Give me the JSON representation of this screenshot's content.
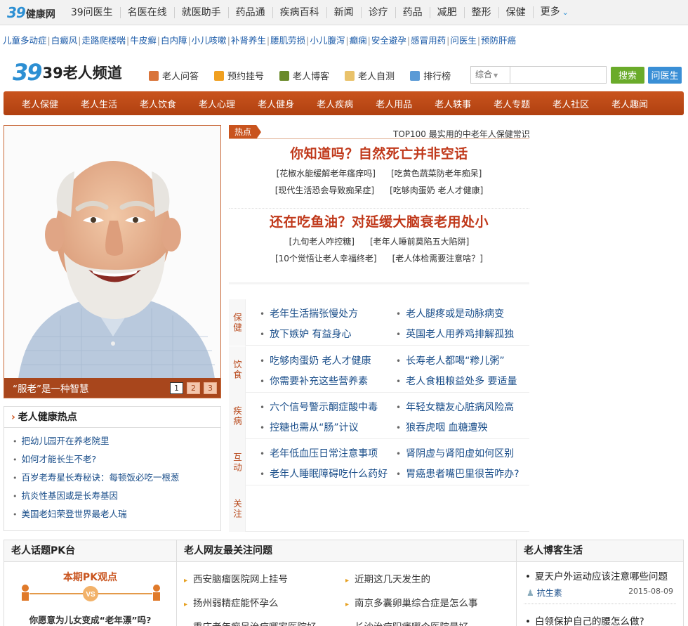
{
  "topnav": {
    "logo_num": "39",
    "logo_text": "健康网",
    "items": [
      "39问医生",
      "名医在线",
      "就医助手",
      "药品通",
      "疾病百科",
      "新闻",
      "诊疗",
      "药品",
      "减肥",
      "整形",
      "保健"
    ],
    "more_label": "更多"
  },
  "keywords": [
    "儿童多动症",
    "白癜风",
    "走路爬楼喘",
    "牛皮癣",
    "白内障",
    "小儿咳嗽",
    "补肾养生",
    "腰肌劳损",
    "小儿腹泻",
    "癫痫",
    "安全避孕",
    "感冒用药",
    "问医生",
    "预防肝癌"
  ],
  "channel": {
    "logo_num": "39",
    "title": "39老人频道",
    "quick_links": [
      {
        "label": "老人问答",
        "icon": "person-ask-icon"
      },
      {
        "label": "预约挂号",
        "icon": "calendar-icon"
      },
      {
        "label": "老人博客",
        "icon": "blog-icon"
      },
      {
        "label": "老人自测",
        "icon": "self-test-icon"
      },
      {
        "label": "排行榜",
        "icon": "bar-chart-icon"
      }
    ]
  },
  "search": {
    "type_label": "综合",
    "placeholder": "",
    "button_label": "搜索",
    "ask_label": "问医生",
    "colors": {
      "search": "#6aab2a",
      "ask": "#3a8fd6"
    }
  },
  "categories": [
    "老人保健",
    "老人生活",
    "老人饮食",
    "老人心理",
    "老人健身",
    "老人疾病",
    "老人用品",
    "老人轶事",
    "老人专题",
    "老人社区",
    "老人趣闻"
  ],
  "slideshow": {
    "caption": "“服老”是一种智慧",
    "pages": [
      "1",
      "2",
      "3"
    ],
    "current": "1"
  },
  "hot_box": {
    "title": "老人健康热点",
    "items": [
      "把幼儿园开在养老院里",
      "如何才能长生不老?",
      "百岁老寿星长寿秘诀：每顿饭必吃一根葱",
      "抗炎性基因或是长寿基因",
      "美国老妇荣登世界最老人瑞"
    ]
  },
  "headlines": {
    "tag": "热点",
    "top100": "TOP100 最实用的中老年人保健常识",
    "h1": "你知道吗？自然死亡并非空话",
    "h1_subs": [
      [
        "[花椒水能缓解老年瘙痒吗]",
        "[吃黄色蔬菜防老年痴呆]"
      ],
      [
        "[现代生活恐会导致痴呆症]",
        "[吃够肉蛋奶 老人才健康]"
      ]
    ],
    "h2": "还在吃鱼油？对延缓大脑衰老用处小",
    "h2_subs": [
      [
        "[九旬老人咋控糖]",
        "[老年人睡前莫陷五大陷阱]"
      ],
      [
        "[10个觉悟让老人幸福终老]",
        "[老人体检需要注意啥？]"
      ]
    ]
  },
  "category_rows": [
    {
      "label": "保健",
      "items": [
        "老年生活揣张慢处方",
        "老人腿疼或是动脉病变",
        "放下嫉妒 有益身心",
        "英国老人用养鸡排解孤独"
      ]
    },
    {
      "label": "饮食",
      "items": [
        "吃够肉蛋奶 老人才健康",
        "长寿老人都喝“糁儿粥”",
        "你需要补充这些营养素",
        "老人食粗粮益处多 要适量"
      ]
    },
    {
      "label": "疾病",
      "items": [
        "六个信号警示酮症酸中毒",
        "年轻女糖友心脏病风险高",
        "控糖也需从“肠”计议",
        "狼吞虎咽 血糖遭殃"
      ]
    },
    {
      "label": "互动",
      "items": [
        "老年低血压日常注意事项",
        "肾阴虚与肾阳虚如何区别",
        "老年人睡眠障碍吃什么药好",
        "胃癌患者嘴巴里很苦咋办?"
      ]
    },
    {
      "label": "关注",
      "items": []
    }
  ],
  "bottom": {
    "pk": {
      "title": "老人话题PK台",
      "subtitle": "本期PK观点",
      "vs": "VS",
      "question": "你愿意为儿女变成“老年漂”吗?"
    },
    "questions": {
      "title": "老人网友最关注问题",
      "left": [
        "西安脑瘤医院网上挂号",
        "扬州弱精症能怀孕么",
        "重庆老年痴呆治疗哪家医院好"
      ],
      "right": [
        "近期这几天发生的",
        "南京多囊卵巢综合症是怎么事",
        "长沙治疗阳痿哪个医院最好"
      ]
    },
    "blog": {
      "title": "老人博客生活",
      "post1": "夏天户外运动应该注意哪些问题",
      "author": "抗生素",
      "date": "2015-08-09",
      "post2": "白领保护自己的腰怎么做?"
    }
  }
}
